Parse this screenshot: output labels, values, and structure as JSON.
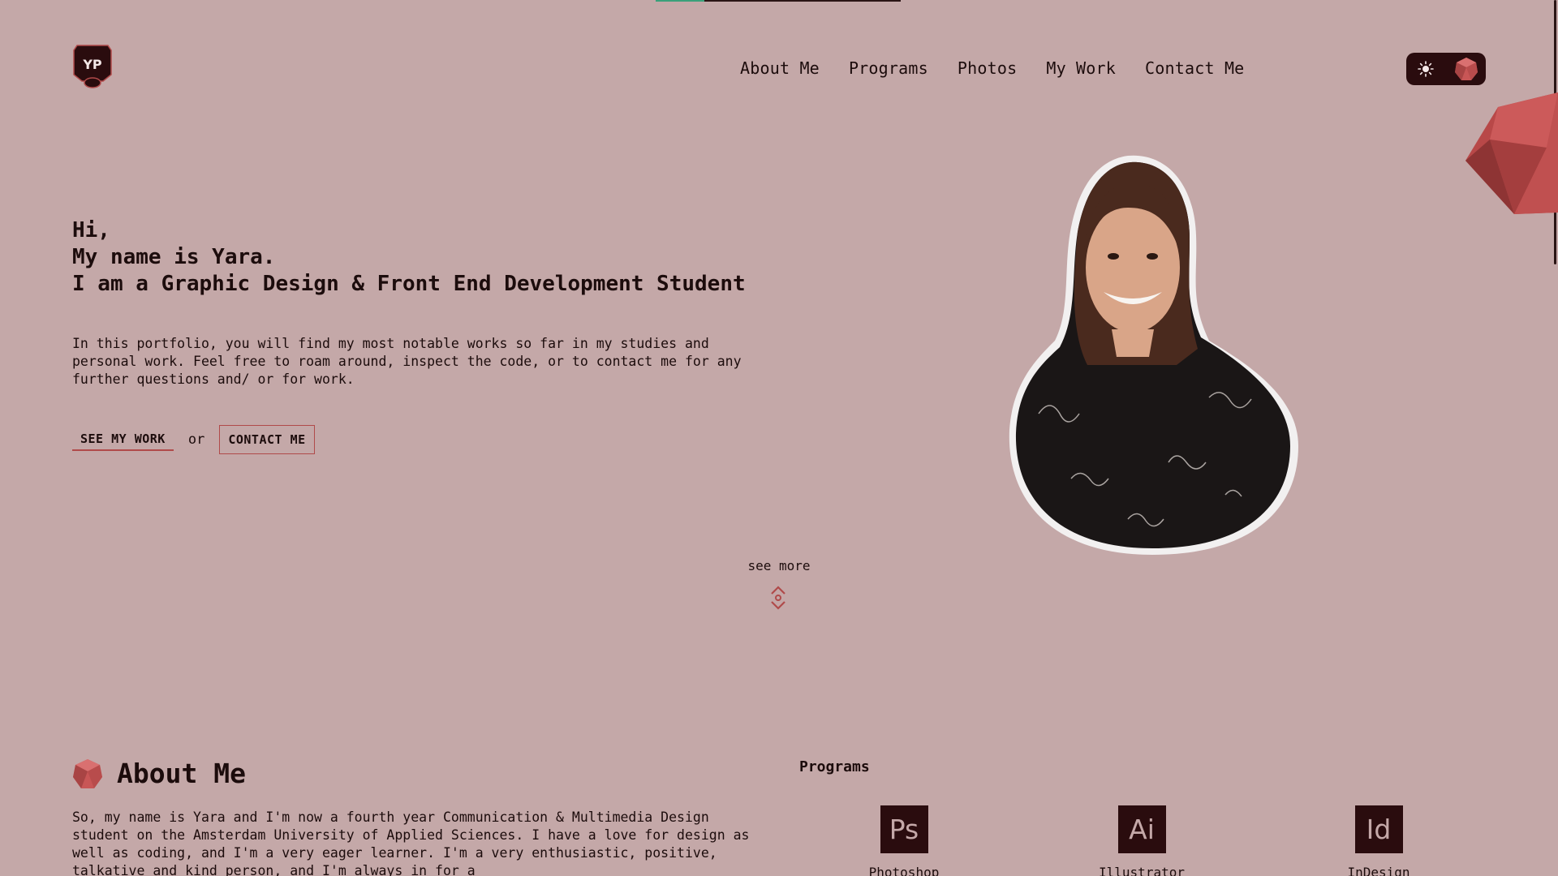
{
  "header": {
    "logo_text": "YP",
    "nav": [
      "About Me",
      "Programs",
      "Photos",
      "My Work",
      "Contact Me"
    ]
  },
  "scroll_progress": 0.2,
  "hero": {
    "greeting": "Hi,",
    "name_line": "My name is Yara.",
    "role_line": "I am a Graphic Design & Front End Development Student",
    "intro": "In this portfolio, you will find my most notable works so far in my studies and personal work. Feel free to roam around, inspect the code, or to contact me for any further questions and/ or for work.",
    "see_work_label": "SEE MY WORK",
    "or_label": "or",
    "contact_label": "CONTACT ME"
  },
  "see_more_label": "see more",
  "about": {
    "title": "About Me",
    "text": "So, my name is Yara and I'm now a fourth year Communication & Multimedia Design student on the Amsterdam University of Applied Sciences. I have a love for design as well as coding, and I'm a very eager learner. I'm a very enthusiastic, positive, talkative and kind person, and I'm always in for a"
  },
  "programs": {
    "title": "Programs",
    "items": [
      {
        "abbr": "Ps",
        "label": "Photoshop"
      },
      {
        "abbr": "Ai",
        "label": "Illustrator"
      },
      {
        "abbr": "Id",
        "label": "InDesign"
      }
    ]
  },
  "colors": {
    "background": "#c4a8a8",
    "text": "#1c0c0c",
    "accent": "#b04a4a",
    "dark": "#2a0c0e",
    "progress": "#3aa07a"
  },
  "icons": [
    "logo-badge-icon",
    "sun-icon",
    "gem-icon",
    "scroll-arrows-icon"
  ]
}
